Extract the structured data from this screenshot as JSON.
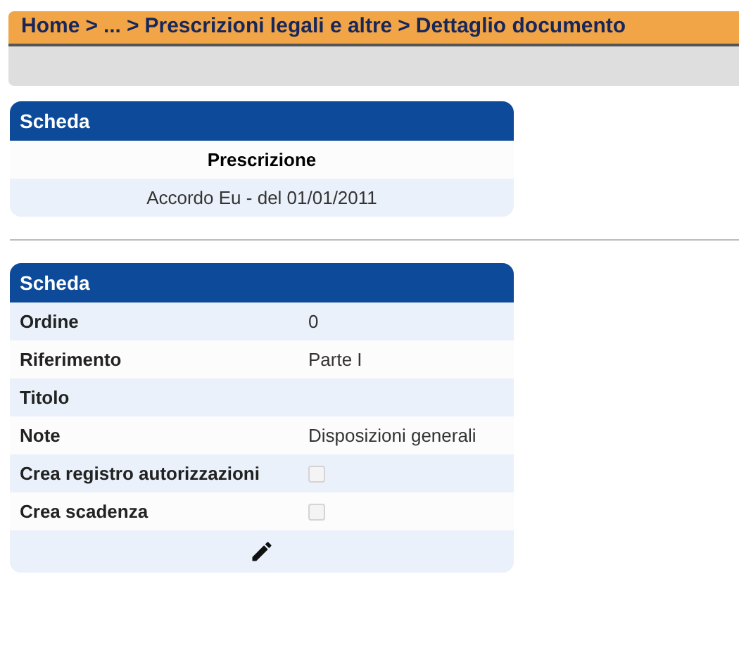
{
  "breadcrumb": [
    "Home",
    ">",
    "...",
    ">",
    "Prescrizioni legali e altre",
    ">",
    "Dettaglio documento"
  ],
  "summary_card": {
    "title": "Scheda",
    "heading": "Prescrizione",
    "value": "Accordo Eu - del 01/01/2011"
  },
  "detail_card": {
    "title": "Scheda",
    "rows": [
      {
        "kind": "text",
        "label": "Ordine",
        "value": "0"
      },
      {
        "kind": "text",
        "label": "Riferimento",
        "value": "Parte I"
      },
      {
        "kind": "text",
        "label": "Titolo"
      },
      {
        "kind": "text",
        "label": "Note",
        "value": "Disposizioni generali"
      },
      {
        "kind": "checkbox",
        "label": "Crea registro autorizzazioni",
        "checked": false
      },
      {
        "kind": "checkbox",
        "label": "Crea scadenza",
        "checked": false
      }
    ]
  }
}
